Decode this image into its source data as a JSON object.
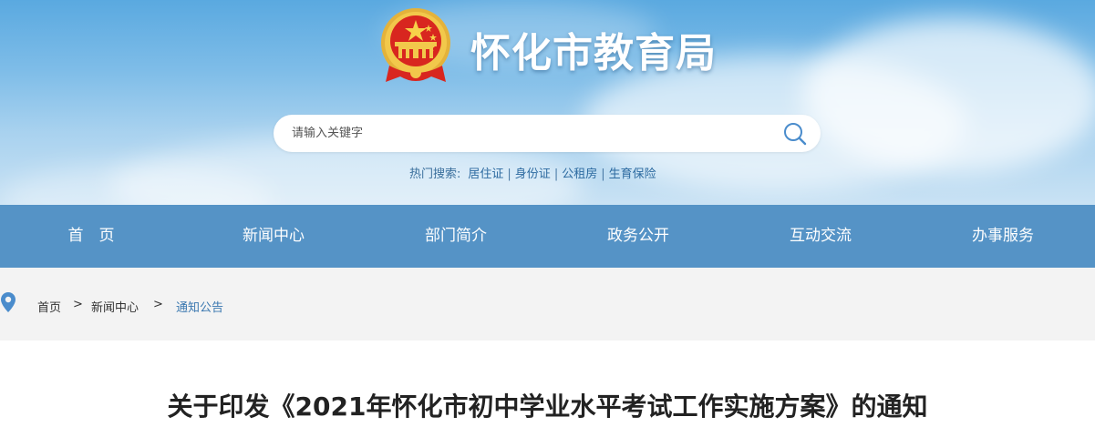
{
  "header": {
    "site_title": "怀化市教育局",
    "emblem_icon": "national-emblem-icon"
  },
  "search": {
    "placeholder": "请输入关键字",
    "button_icon": "search-icon",
    "hot_label": "热门搜索:",
    "hot_terms": [
      "居住证",
      "身份证",
      "公租房",
      "生育保险"
    ]
  },
  "nav": {
    "items": [
      "首　页",
      "新闻中心",
      "部门简介",
      "政务公开",
      "互动交流",
      "办事服务"
    ]
  },
  "breadcrumb": {
    "icon": "location-pin-icon",
    "items": [
      "首页",
      "新闻中心",
      "通知公告"
    ],
    "separator": ">"
  },
  "article": {
    "title": "关于印发《2021年怀化市初中学业水平考试工作实施方案》的通知"
  },
  "colors": {
    "nav_bg": "#5593c6",
    "link": "#3b78b0",
    "breadcrumb_bg": "#f3f3f3"
  }
}
